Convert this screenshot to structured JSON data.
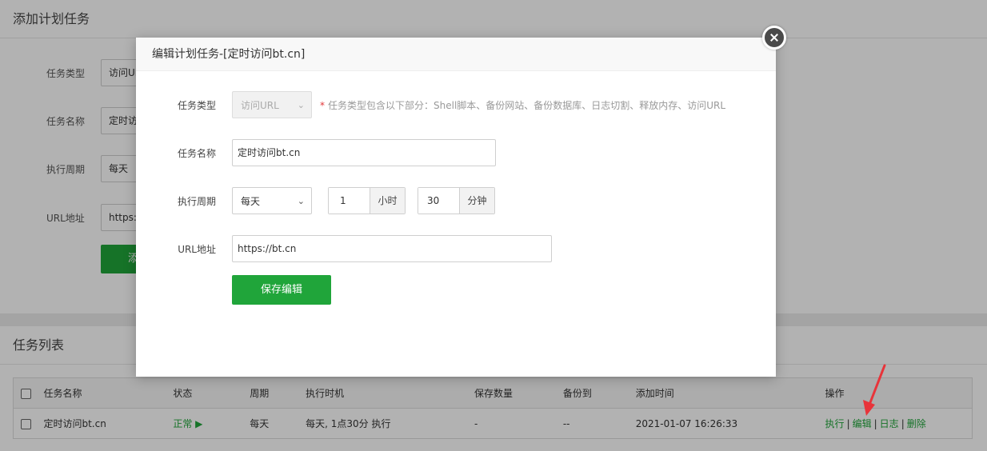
{
  "background": {
    "add_card": {
      "title": "添加计划任务",
      "fields": [
        {
          "label": "任务类型",
          "value": "访问URL"
        },
        {
          "label": "任务名称",
          "value": "定时访问bt.cn"
        },
        {
          "label": "执行周期",
          "value": "每天"
        },
        {
          "label": "URL地址",
          "value": "https://bt.cn"
        }
      ],
      "add_button": "添加任务"
    },
    "list_card": {
      "title": "任务列表",
      "columns": [
        "任务名称",
        "状态",
        "周期",
        "执行时机",
        "保存数量",
        "备份到",
        "添加时间",
        "操作"
      ],
      "rows": [
        {
          "name": "定时访问bt.cn",
          "status": "正常",
          "status_icon": "play-icon",
          "cycle": "每天",
          "timing": "每天, 1点30分 执行",
          "save_count": "-",
          "backup_to": "--",
          "added": "2021-01-07 16:26:33",
          "ops": [
            "执行",
            "编辑",
            "日志",
            "删除"
          ]
        }
      ]
    }
  },
  "modal": {
    "title": "编辑计划任务-[定时访问bt.cn]",
    "close_icon": "close-icon",
    "task_type": {
      "label": "任务类型",
      "value": "访问URL",
      "hint": "任务类型包含以下部分：Shell脚本、备份网站、备份数据库、日志切割、释放内存、访问URL",
      "hint_mark": "*"
    },
    "task_name": {
      "label": "任务名称",
      "value": "定时访问bt.cn"
    },
    "cycle": {
      "label": "执行周期",
      "value": "每天",
      "hour_value": "1",
      "hour_unit": "小时",
      "minute_value": "30",
      "minute_unit": "分钟"
    },
    "url": {
      "label": "URL地址",
      "value": "https://bt.cn"
    },
    "save_button": "保存编辑"
  },
  "colors": {
    "accent": "#20a53a",
    "annotation_arrow": "#e8343a",
    "required_mark": "#e2383a"
  },
  "annotation": {
    "icon": "red-arrow-icon",
    "points_to": "编辑"
  }
}
